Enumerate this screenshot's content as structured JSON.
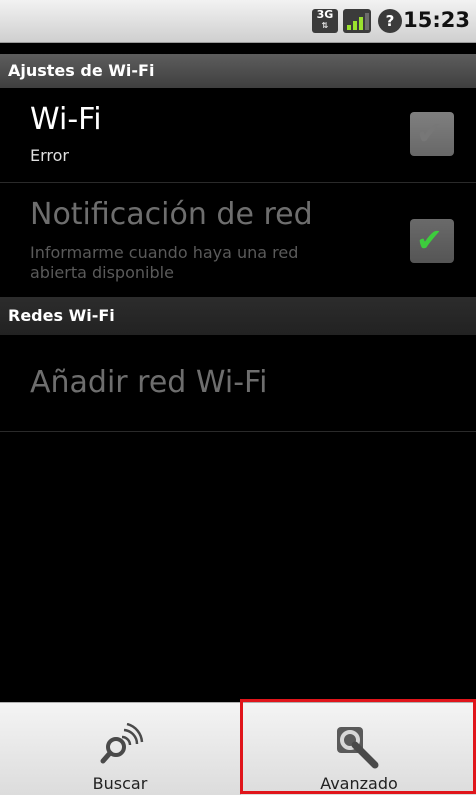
{
  "status_bar": {
    "network_type": "3G",
    "network_arrows": "⇅",
    "battery_glyph": "?",
    "time": "15:23"
  },
  "wifi_settings": {
    "header": "Ajustes de Wi-Fi",
    "wifi": {
      "title": "Wi-Fi",
      "summary": "Error",
      "checked": true
    },
    "notification": {
      "title": "Notificación de red",
      "summary_line1": "Informarme cuando haya una red",
      "summary_line2": "abierta disponible",
      "checked": true
    }
  },
  "networks": {
    "header": "Redes Wi-Fi",
    "add_network": "Añadir red Wi-Fi"
  },
  "menu": {
    "items": [
      {
        "label": "Buscar",
        "icon": "search-wifi-icon"
      },
      {
        "label": "Avanzado",
        "icon": "wrench-magnifier-icon"
      }
    ],
    "highlight_color": "#e0151b"
  },
  "icons": {
    "checkmark_glyph": "✔"
  }
}
